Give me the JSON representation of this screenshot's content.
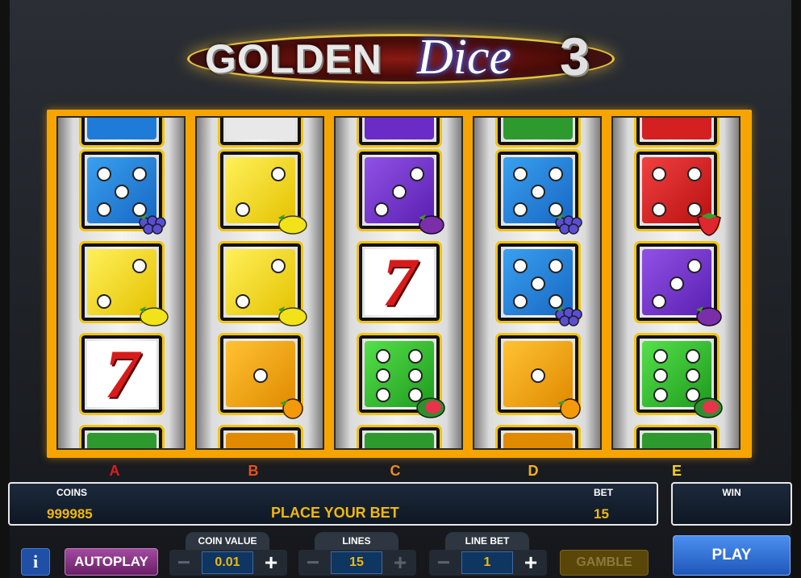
{
  "title": {
    "word1": "GOLDEN",
    "word2": "Dice",
    "number": "3"
  },
  "reels": [
    {
      "letter": "A",
      "letter_color": "#e11b1b"
    },
    {
      "letter": "B",
      "letter_color": "#e5521d"
    },
    {
      "letter": "C",
      "letter_color": "#f28a1c"
    },
    {
      "letter": "D",
      "letter_color": "#f5b01c"
    },
    {
      "letter": "E",
      "letter_color": "#f7d11c"
    }
  ],
  "symbols": {
    "seven_glyph": "7",
    "icons": [
      "blue-die-four-icon",
      "grapes-icon",
      "yellow-die-two-icon",
      "lemon-icon",
      "seven-icon",
      "purple-die-three-icon",
      "plum-icon",
      "blue-die-five-icon",
      "orange-die-one-icon",
      "orange-icon",
      "green-die-six-icon",
      "watermelon-icon",
      "red-die-four-icon",
      "strawberry-icon"
    ]
  },
  "infobar": {
    "coins_label": "COINS",
    "coins_value": "999985",
    "message": "PLACE YOUR BET",
    "bet_label": "BET",
    "bet_value": "15"
  },
  "win": {
    "label": "WIN",
    "value": ""
  },
  "controls": {
    "info_label": "i",
    "autoplay_label": "AUTOPLAY",
    "coin_value_label": "COIN VALUE",
    "coin_value": "0.01",
    "lines_label": "LINES",
    "lines_value": "15",
    "line_bet_label": "LINE BET",
    "line_bet_value": "1",
    "minus": "−",
    "plus": "+",
    "gamble_label": "GAMBLE",
    "play_label": "PLAY"
  },
  "colors": {
    "accent": "#f1b80c",
    "frame": "#f5a400",
    "play": "#2f6fd1",
    "autoplay": "#7d2a7a"
  }
}
